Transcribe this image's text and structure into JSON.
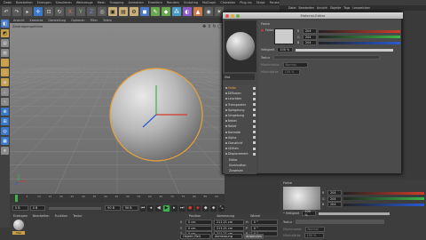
{
  "menubar": {
    "items": [
      "Datei",
      "Bearbeiten",
      "Erzeugen",
      "Simulieren",
      "Werkzeuge",
      "Mesh",
      "Snapping",
      "Animation",
      "Erweitern",
      "Rendern",
      "Sculpting",
      "MoGraph",
      "Charakter",
      "Plug-ins",
      "Skript",
      "Fenster",
      "Hilfe"
    ],
    "layout_label": "Layout:",
    "layout_value": "Start"
  },
  "viewport": {
    "menu": [
      "Ansicht",
      "Kameras",
      "Darstellung",
      "Optionen",
      "Filter",
      "Tafeln"
    ],
    "label": "Zentralperspektive"
  },
  "timeline": {
    "ticks": [
      "0",
      "5",
      "10",
      "15",
      "20",
      "25",
      "30",
      "35",
      "40",
      "45",
      "50",
      "55",
      "60",
      "65",
      "70",
      "75",
      "80",
      "85",
      "90"
    ],
    "current_frame": "0 B",
    "start": "0 B",
    "end": "90 B",
    "end2": "90 B"
  },
  "material_manager": {
    "menu": [
      "Erzeugen",
      "Bearbeiten",
      "Funktion",
      "Textur"
    ],
    "material_name": "Mat"
  },
  "coordinates": {
    "headers": [
      "Position",
      "Abmessung",
      "Winkel"
    ],
    "rows": [
      {
        "axis": "X",
        "pos": "0 cm",
        "size": "211.21 cm",
        "angle_axis": "H",
        "angle": "0 °"
      },
      {
        "axis": "Y",
        "pos": "0 cm",
        "size": "211.21 cm",
        "angle_axis": "P",
        "angle": "0 °"
      },
      {
        "axis": "Z",
        "pos": "0 cm",
        "size": "211.21 cm",
        "angle_axis": "B",
        "angle": "0 °"
      }
    ],
    "mode": "Objekt (Rel)",
    "size_mode": "Abmessung",
    "apply": "Anwenden"
  },
  "right_panel": {
    "tabs": [
      "Datei",
      "Bearbeiten",
      "Ansicht",
      "Objekte",
      "Tags",
      "Lesezeichen"
    ],
    "attr_section": "Farbe",
    "attr_rows": [
      {
        "label": "R",
        "value": "204"
      },
      {
        "label": "G",
        "value": "204"
      },
      {
        "label": "B",
        "value": "204"
      }
    ],
    "helligkeit": "100 %",
    "textur_label": "Textur",
    "mischmodus_label": "Mischmodus",
    "mischmodus_value": "Normal",
    "mischstaerke_label": "Mischstärke",
    "mischstaerke_value": "100 %"
  },
  "material_editor": {
    "title": "Material-Editor",
    "material_name": "Mat",
    "section": "Farbe",
    "farbe_label": "Farbe",
    "rows": [
      {
        "label": "R",
        "value": "204"
      },
      {
        "label": "G",
        "value": "204"
      },
      {
        "label": "B",
        "value": "204"
      }
    ],
    "helligkeit_label": "Helligkeit",
    "helligkeit_value": "100 %",
    "textur_label": "Textur",
    "mischmodus_label": "Mischmodus",
    "mischmodus_value": "Normal",
    "mischstaerke_label": "Mischstärke",
    "mischstaerke_value": "100 %",
    "channels": [
      {
        "name": "Farbe",
        "checked": true,
        "active": true
      },
      {
        "name": "Diffusion",
        "checked": true,
        "active": false
      },
      {
        "name": "Leuchten",
        "checked": true,
        "active": false
      },
      {
        "name": "Transparenz",
        "checked": true,
        "active": false
      },
      {
        "name": "Spiegelung",
        "checked": true,
        "active": false
      },
      {
        "name": "Umgebung",
        "checked": true,
        "active": false
      },
      {
        "name": "Nebel",
        "checked": true,
        "active": false
      },
      {
        "name": "Relief",
        "checked": true,
        "active": false
      },
      {
        "name": "Normale",
        "checked": true,
        "active": false
      },
      {
        "name": "Alpha",
        "checked": true,
        "active": false
      },
      {
        "name": "Glanzlicht",
        "checked": true,
        "active": false
      },
      {
        "name": "Glühen",
        "checked": true,
        "active": false
      },
      {
        "name": "Displacement",
        "checked": true,
        "active": false
      },
      {
        "name": "Editor",
        "checked": false,
        "active": false
      },
      {
        "name": "Illumination",
        "checked": false,
        "active": false
      },
      {
        "name": "Zuweisen",
        "checked": false,
        "active": false
      }
    ]
  },
  "colors": {
    "accent_orange": "#e8a23a",
    "red": "#d23a2a",
    "green": "#3cb44a",
    "blue": "#2a5ad2",
    "selected_blue": "#3a78c8"
  }
}
